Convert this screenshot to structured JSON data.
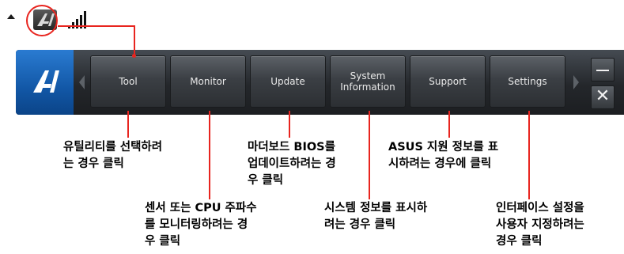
{
  "tray": {
    "arrow_icon": "caret-up-icon",
    "app_icon": "ai-suite-icon",
    "network_icon": "signal-bars-icon"
  },
  "toolbar": {
    "logo_icon": "ai-suite-logo-icon",
    "buttons": [
      {
        "label": "Tool"
      },
      {
        "label": "Monitor"
      },
      {
        "label": "Update"
      },
      {
        "label_line1": "System",
        "label_line2": "Information"
      },
      {
        "label": "Support"
      },
      {
        "label": "Settings"
      }
    ],
    "minimize_icon": "minimize-icon",
    "close_icon": "close-icon",
    "close_glyph": "✕"
  },
  "annotations": {
    "tool": [
      "유틸리티를 선택하려",
      "는 경우 클릭"
    ],
    "monitor": [
      "센서 또는 CPU 주파수",
      "를 모니터링하려는 경",
      "우 클릭"
    ],
    "update": [
      "마더보드 BIOS를",
      "업데이트하려는 경",
      "우 클릭"
    ],
    "sysinfo": [
      "시스템 정보를 표시하",
      "려는 경우 클릭"
    ],
    "support": [
      "ASUS 지원 정보를 표",
      "시하려는 경우에 클릭"
    ],
    "settings": [
      "인터페이스 설정을",
      "사용자 지정하려는",
      "경우 클릭"
    ]
  },
  "colors": {
    "callout": "#e8251f",
    "toolbar_bg": "#2a2d31",
    "logo_tile": "#1a64b8"
  }
}
